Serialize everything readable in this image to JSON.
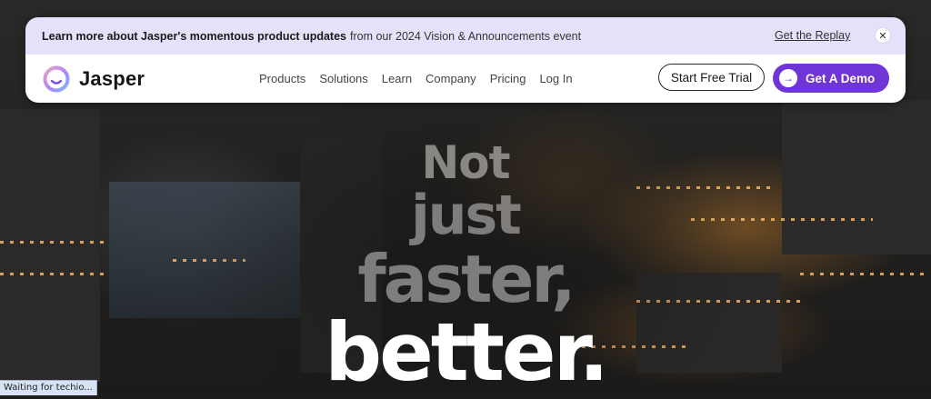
{
  "announcement": {
    "bold_text": "Learn more about Jasper's momentous product updates",
    "rest_text": "from our 2024 Vision & Announcements event",
    "link_label": "Get the Replay",
    "close_symbol": "✕"
  },
  "brand": {
    "name": "Jasper",
    "logo_icon": "jasper-smile-ring-icon",
    "logo_colors": [
      "#f0a2c4",
      "#b086f7",
      "#7ab4ff"
    ]
  },
  "nav": {
    "items": [
      "Products",
      "Solutions",
      "Learn",
      "Company",
      "Pricing",
      "Log In"
    ]
  },
  "cta": {
    "trial_label": "Start Free Trial",
    "demo_label": "Get A Demo",
    "demo_icon": "arrow-right-icon",
    "accent_color": "#6f35d6"
  },
  "hero": {
    "line1": "Not",
    "line2": "just",
    "line3": "faster,",
    "line4": "better."
  },
  "status_bar": {
    "text": "Waiting for techio..."
  }
}
